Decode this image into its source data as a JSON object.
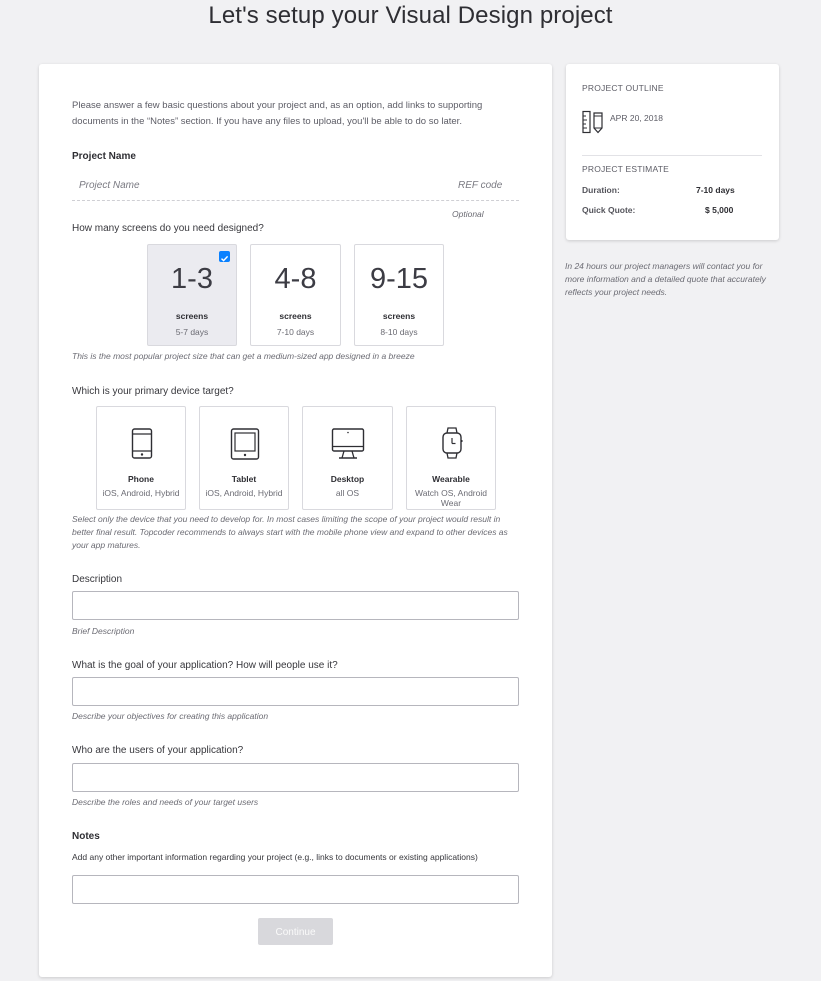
{
  "page": {
    "title": "Let's setup your Visual Design project"
  },
  "form": {
    "intro": "Please answer a few basic questions about your project and, as an option, add links to supporting documents in the “Notes” section. If you have any files to upload, you'll be able to do so later.",
    "project_name": {
      "label": "Project Name",
      "placeholder": "Project Name",
      "ref_placeholder": "REF code",
      "ref_hint": "Optional"
    },
    "screens": {
      "question": "How many screens do you need designed?",
      "options": [
        {
          "range": "1-3",
          "unit": "screens",
          "duration": "5-7 days",
          "selected": true
        },
        {
          "range": "4-8",
          "unit": "screens",
          "duration": "7-10 days",
          "selected": false
        },
        {
          "range": "9-15",
          "unit": "screens",
          "duration": "8-10 days",
          "selected": false
        }
      ],
      "hint": "This is the most popular project size that can get a medium-sized app designed in a breeze"
    },
    "device": {
      "question": "Which is your primary device target?",
      "options": [
        {
          "name": "Phone",
          "platforms": "iOS, Android, Hybrid",
          "icon": "phone-icon"
        },
        {
          "name": "Tablet",
          "platforms": "iOS, Android, Hybrid",
          "icon": "tablet-icon"
        },
        {
          "name": "Desktop",
          "platforms": "all OS",
          "icon": "desktop-icon"
        },
        {
          "name": "Wearable",
          "platforms": "Watch OS, Android Wear",
          "icon": "watch-icon"
        }
      ],
      "hint": "Select only the device that you need to develop for. In most cases limiting the scope of your project would result in better final result. Topcoder recommends to always start with the mobile phone view and expand to other devices as your app matures."
    },
    "description": {
      "label": "Description",
      "hint": "Brief Description"
    },
    "goal": {
      "label": "What is the goal of your application? How will people use it?",
      "hint": "Describe your objectives for creating this application"
    },
    "users": {
      "label": "Who are the users of your application?",
      "hint": "Describe the roles and needs of your target users"
    },
    "notes": {
      "label": "Notes",
      "sublabel": "Add any other important information regarding your project (e.g., links to documents or existing applications)"
    },
    "continue_label": "Continue"
  },
  "sidebar": {
    "outline_heading": "PROJECT OUTLINE",
    "date": "APR 20, 2018",
    "estimate_heading": "PROJECT ESTIMATE",
    "duration_label": "Duration:",
    "duration_value": "7-10 days",
    "quote_label": "Quick Quote:",
    "quote_value": "$ 5,000",
    "note": "In 24 hours our project managers will contact you for more information and a detailed quote that accurately reflects your project needs."
  },
  "colors": {
    "accent": "#0a81ff",
    "background": "#f1f1f3",
    "button_disabled": "#d8d8dc"
  }
}
